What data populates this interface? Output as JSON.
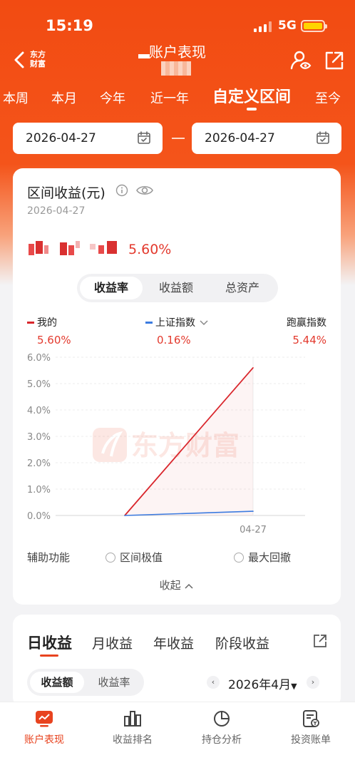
{
  "status_bar": {
    "time": "15:19",
    "network": "5G"
  },
  "nav": {
    "logo": {
      "line1": "东方",
      "line2": "财富"
    },
    "title": "账户表现"
  },
  "period_tabs": [
    {
      "label": "本周",
      "active": false
    },
    {
      "label": "本月",
      "active": false
    },
    {
      "label": "今年",
      "active": false
    },
    {
      "label": "近一年",
      "active": false
    },
    {
      "label": "自定义区间",
      "active": true
    },
    {
      "label": "至今",
      "active": false
    }
  ],
  "date_range": {
    "start": "2026-04-27",
    "end": "2026-04-27"
  },
  "summary": {
    "title": "区间收益(元)",
    "date": "2026-04-27",
    "rate": "5.60%"
  },
  "metric_tabs": [
    {
      "label": "收益率",
      "active": true
    },
    {
      "label": "收益额",
      "active": false
    },
    {
      "label": "总资产",
      "active": false
    }
  ],
  "legend": [
    {
      "name": "我的",
      "value": "5.60%",
      "color": "#d9262c"
    },
    {
      "name": "上证指数",
      "value": "0.16%",
      "color": "#3b7be0"
    },
    {
      "name": "跑赢指数",
      "value": "5.44%"
    }
  ],
  "watermark": "东方财富",
  "chart_data": {
    "type": "line",
    "y_ticks": [
      "6.0%",
      "5.0%",
      "4.0%",
      "3.0%",
      "2.0%",
      "1.0%",
      "0.0%"
    ],
    "ylim": [
      0,
      6
    ],
    "x_label": "04-27",
    "series": [
      {
        "name": "我的",
        "color": "#d9262c",
        "points": [
          [
            0,
            0.0
          ],
          [
            1,
            5.6
          ]
        ]
      },
      {
        "name": "上证指数",
        "color": "#3b7be0",
        "points": [
          [
            0,
            0.0
          ],
          [
            1,
            0.16
          ]
        ]
      }
    ]
  },
  "aux": {
    "label": "辅助功能",
    "opt1": "区间极值",
    "opt2": "最大回撤"
  },
  "collapse": "收起",
  "income_tabs": [
    {
      "label": "日收益",
      "active": true
    },
    {
      "label": "月收益",
      "active": false
    },
    {
      "label": "年收益",
      "active": false
    },
    {
      "label": "阶段收益",
      "active": false
    }
  ],
  "income_seg": [
    {
      "label": "收益额",
      "active": true
    },
    {
      "label": "收益率",
      "active": false
    }
  ],
  "month_picker": "2026年4月",
  "tabbar": [
    {
      "label": "账户表现",
      "active": true
    },
    {
      "label": "收益排名",
      "active": false
    },
    {
      "label": "持仓分析",
      "active": false
    },
    {
      "label": "投资账单",
      "active": false
    }
  ],
  "colors": {
    "brand": "#f24b12",
    "accent": "#e8431f",
    "up": "#e33a2e"
  }
}
